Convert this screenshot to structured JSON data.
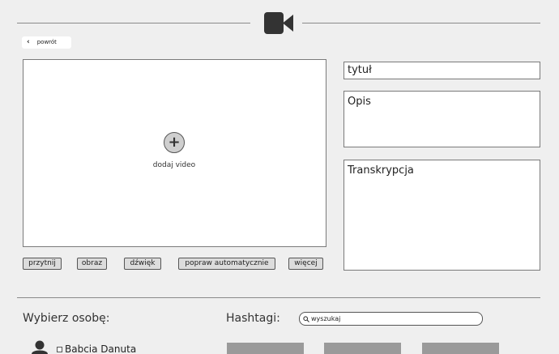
{
  "header": {
    "icon": "video-camera-icon",
    "back_label": "powrót"
  },
  "video": {
    "add_label": "dodaj video"
  },
  "toolbar": {
    "trim_label": "przytnij",
    "image_label": "obraz",
    "sound_label": "dźwięk",
    "auto_fix_label": "popraw automatycznie",
    "more_label": "więcej"
  },
  "form": {
    "title_placeholder": "tytuł",
    "description_placeholder": "Opis",
    "transcription_placeholder": "Transkrypcja"
  },
  "people": {
    "heading": "Wybierz osobę:",
    "items": [
      {
        "name": "Babcia Danuta",
        "checked": false
      }
    ]
  },
  "hashtags": {
    "heading": "Hashtagi:",
    "search_placeholder": "wyszukaj"
  },
  "colors": {
    "background": "#efefef",
    "panel": "#ffffff",
    "tag_box": "#9a9a9a",
    "icon_dark": "#333333"
  }
}
